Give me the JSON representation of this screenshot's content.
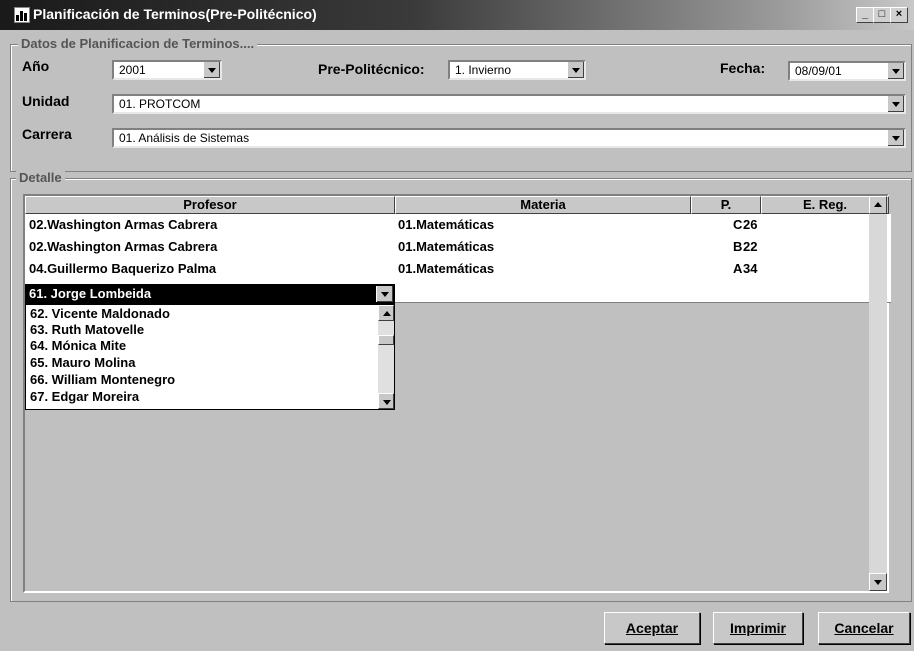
{
  "window": {
    "title": "Planificación de Terminos(Pre-Politécnico)",
    "min": "_",
    "max": "□",
    "close": "×"
  },
  "datos": {
    "legend": "Datos de Planificacion de Terminos....",
    "anio_label": "Año",
    "anio_value": "2001",
    "prepoli_label": "Pre-Politécnico:",
    "prepoli_value": "1. Invierno",
    "fecha_label": "Fecha:",
    "fecha_value": "08/09/01",
    "unidad_label": "Unidad",
    "unidad_value": "01. PROTCOM",
    "carrera_label": "Carrera",
    "carrera_value": "01. Análisis de Sistemas"
  },
  "detalle": {
    "legend": "Detalle",
    "columns": [
      "Profesor",
      "Materia",
      "P.",
      "E. Reg."
    ],
    "rows": [
      {
        "profesor": "02.Washington Armas Cabrera",
        "materia": "01.Matemáticas",
        "p": "C",
        "ereg": "26"
      },
      {
        "profesor": "02.Washington Armas Cabrera",
        "materia": "01.Matemáticas",
        "p": "B",
        "ereg": "22"
      },
      {
        "profesor": "04.Guillermo Baquerizo Palma",
        "materia": "01.Matemáticas",
        "p": "A",
        "ereg": "34"
      }
    ],
    "edit_value": "61. Jorge Lombeida",
    "dropdown_items": [
      "62. Vicente Maldonado",
      "63. Ruth Matovelle",
      "64. Mónica Mite",
      "65. Mauro Molina",
      "66. William Montenegro",
      "67. Edgar Moreira"
    ]
  },
  "buttons": {
    "aceptar": "Aceptar",
    "imprimir": "Imprimir",
    "cancelar": "Cancelar"
  }
}
